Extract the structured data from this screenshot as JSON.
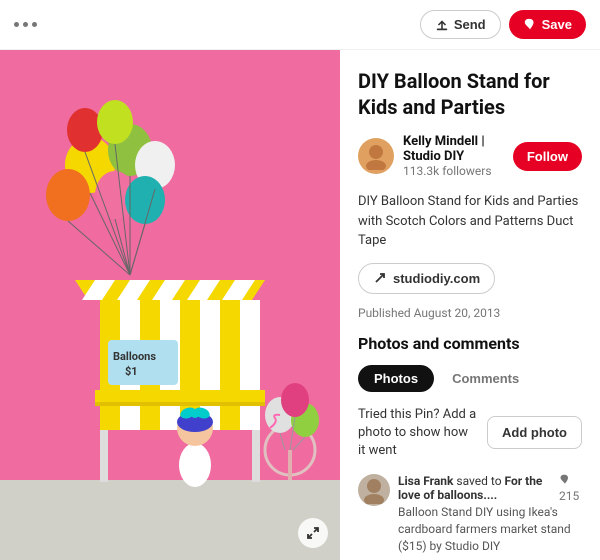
{
  "topbar": {
    "send_label": "Send",
    "save_label": "Save"
  },
  "pin": {
    "title": "DIY Balloon Stand for Kids and Parties",
    "description": "DIY Balloon Stand for Kids and Parties with Scotch Colors and Patterns Duct Tape",
    "link": "studiodiy.com",
    "published": "Published August 20, 2013"
  },
  "author": {
    "name": "Kelly Mindell | Studio DIY",
    "followers": "113.3k followers",
    "follow_label": "Follow"
  },
  "photos_comments": {
    "section_title": "Photos and comments",
    "tab_photos": "Photos",
    "tab_comments": "Comments",
    "tried_text": "Tried this Pin? Add a photo to show how it went",
    "add_photo_label": "Add photo"
  },
  "comment": {
    "commenter": "Lisa Frank",
    "saved_text": "saved to",
    "board": "For the love of balloons....",
    "saves": "215",
    "body": "Balloon Stand DIY using Ikea's cardboard farmers market stand ($15) by Studio DIY"
  },
  "icons": {
    "expand": "⊕",
    "arrow_up_right": "↗",
    "pin_icon": "📌",
    "send_icon": "⬆"
  }
}
